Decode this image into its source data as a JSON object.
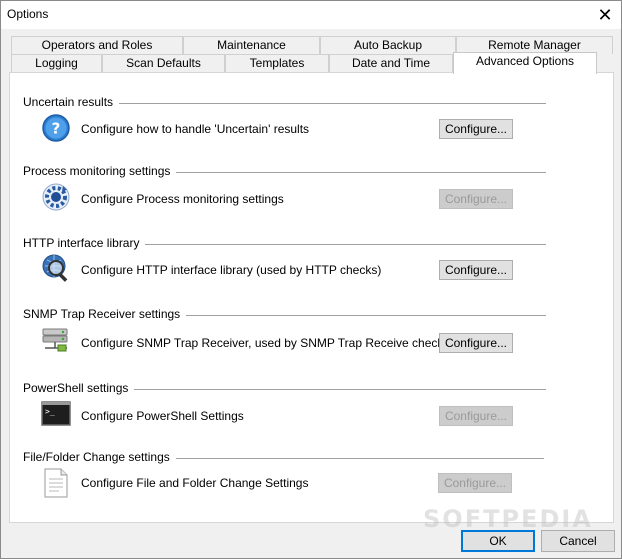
{
  "window": {
    "title": "Options",
    "close_glyph": "✕"
  },
  "tabs_row1": [
    {
      "label": "Operators and Roles"
    },
    {
      "label": "Maintenance"
    },
    {
      "label": "Auto Backup"
    },
    {
      "label": "Remote Manager"
    }
  ],
  "tabs_row2": [
    {
      "label": "Logging"
    },
    {
      "label": "Scan Defaults"
    },
    {
      "label": "Templates"
    },
    {
      "label": "Date and Time"
    },
    {
      "label": "Advanced Options",
      "active": true
    }
  ],
  "groups": [
    {
      "title": "Uncertain results",
      "text": "Configure how to handle 'Uncertain' results",
      "button": "Configure...",
      "enabled": true,
      "icon": "question-icon"
    },
    {
      "title": "Process monitoring settings",
      "text": "Configure Process monitoring settings",
      "button": "Configure...",
      "enabled": false,
      "icon": "process-gear-icon"
    },
    {
      "title": "HTTP interface library",
      "text": "Configure HTTP interface library (used by HTTP checks)",
      "button": "Configure...",
      "enabled": true,
      "icon": "globe-magnifier-icon"
    },
    {
      "title": "SNMP Trap Receiver settings",
      "text": "Configure SNMP Trap Receiver, used by SNMP Trap Receive checks",
      "button": "Configure...",
      "enabled": true,
      "icon": "network-server-icon"
    },
    {
      "title": "PowerShell settings",
      "text": "Configure PowerShell Settings",
      "button": "Configure...",
      "enabled": false,
      "icon": "console-icon"
    },
    {
      "title": "File/Folder Change settings",
      "text": "Configure File and Folder Change Settings",
      "button": "Configure...",
      "enabled": false,
      "icon": "document-icon"
    }
  ],
  "footer": {
    "ok_label": "OK",
    "cancel_label": "Cancel"
  },
  "watermark": "SOFTPEDIA"
}
